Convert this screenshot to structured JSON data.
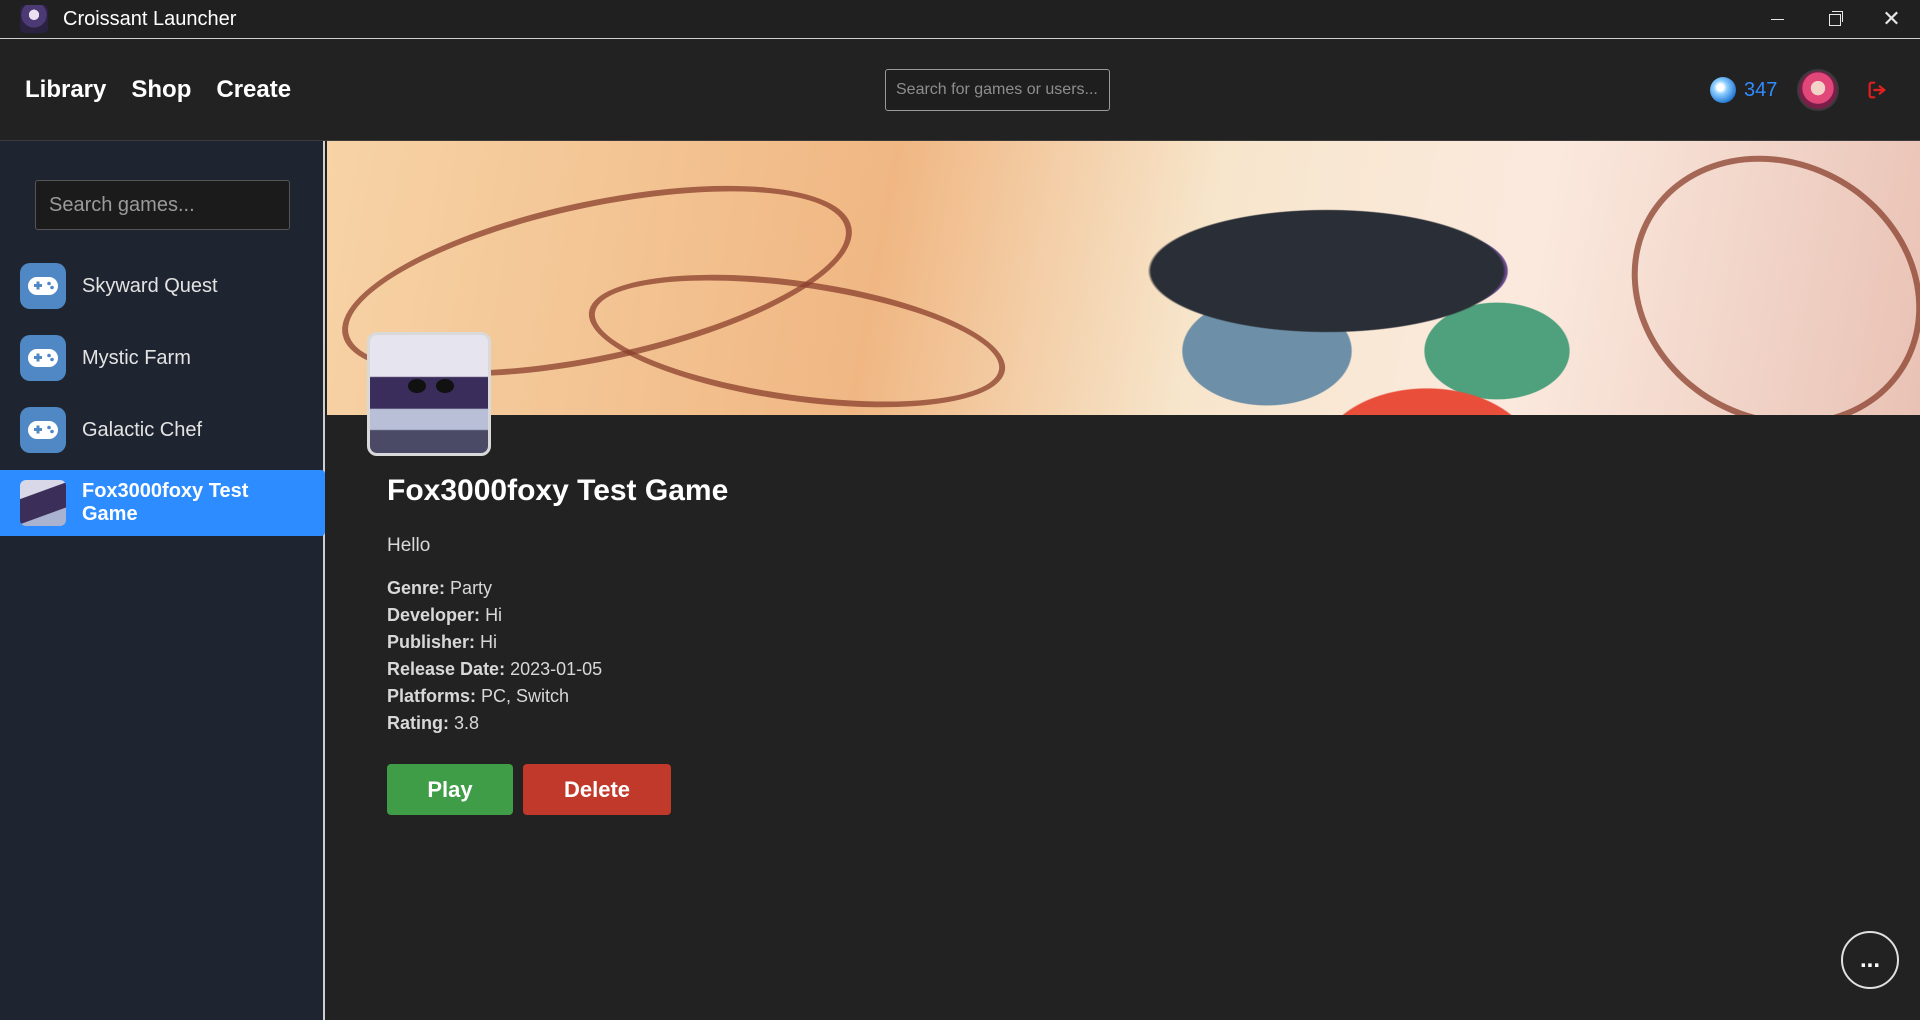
{
  "window": {
    "title": "Croissant Launcher",
    "app_icon": "croissant-app-icon",
    "controls": [
      "minimize-icon",
      "restore-icon",
      "close-icon"
    ]
  },
  "header": {
    "nav": [
      {
        "label": "Library"
      },
      {
        "label": "Shop"
      },
      {
        "label": "Create"
      }
    ],
    "search": {
      "placeholder": "Search for games or users..."
    },
    "currency": {
      "icon": "gem-icon",
      "amount": "347",
      "color": "#2f8cff"
    },
    "avatar": "user-avatar",
    "logout_icon": "logout-icon",
    "logout_color": "#e02020"
  },
  "sidebar": {
    "search": {
      "placeholder": "Search games..."
    },
    "games": [
      {
        "label": "Skyward Quest",
        "icon": "gamepad-icon",
        "active": false
      },
      {
        "label": "Mystic Farm",
        "icon": "gamepad-icon",
        "active": false
      },
      {
        "label": "Galactic Chef",
        "icon": "gamepad-icon",
        "active": false
      },
      {
        "label": "Fox3000foxy Test Game",
        "icon": "game-thumbnail",
        "active": true
      }
    ],
    "active_color": "#2d8cff"
  },
  "game": {
    "title": "Fox3000foxy Test Game",
    "description": "Hello",
    "details": {
      "genre_label": "Genre:",
      "genre": "Party",
      "developer_label": "Developer:",
      "developer": "Hi",
      "publisher_label": "Publisher:",
      "publisher": "Hi",
      "release_label": "Release Date:",
      "release_date": "2023-01-05",
      "platforms_label": "Platforms:",
      "platforms": "PC, Switch",
      "rating_label": "Rating:",
      "rating": "3.8"
    },
    "play_label": "Play",
    "delete_label": "Delete",
    "play_color": "#3e9d46",
    "delete_color": "#c0392b"
  },
  "chat_button": {
    "label": "..."
  }
}
